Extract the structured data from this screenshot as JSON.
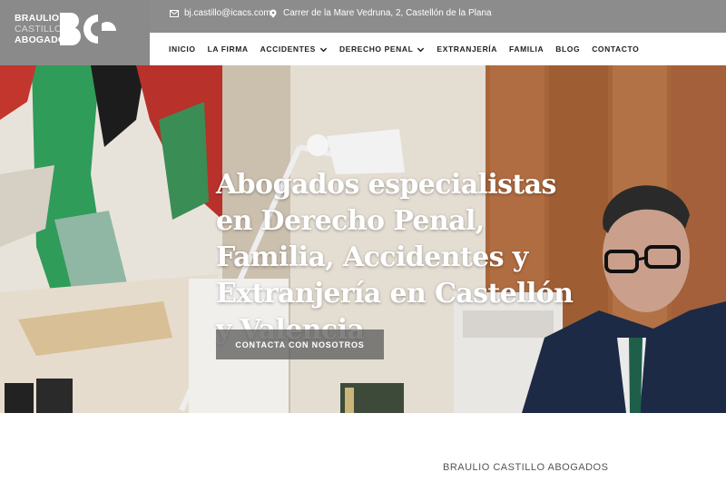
{
  "logo": {
    "line1": "BRAULIO",
    "line2": "CASTILLO",
    "line3": "ABOGADOS"
  },
  "topbar": {
    "email": "bj.castillo@icacs.com",
    "address": "Carrer de la Mare Vedruna, 2, Castellón de la Plana",
    "email_icon": "envelope-icon",
    "address_icon": "map-pin-icon"
  },
  "nav": {
    "items": [
      {
        "label": "INICIO",
        "dropdown": false
      },
      {
        "label": "LA FIRMA",
        "dropdown": false
      },
      {
        "label": "ACCIDENTES",
        "dropdown": true
      },
      {
        "label": "DERECHO PENAL",
        "dropdown": true
      },
      {
        "label": "EXTRANJERÍA",
        "dropdown": false
      },
      {
        "label": "FAMILIA",
        "dropdown": false
      },
      {
        "label": "BLOG",
        "dropdown": false
      },
      {
        "label": "CONTACTO",
        "dropdown": false
      }
    ]
  },
  "hero": {
    "title": "Abogados especialistas en Derecho Penal, Familia, Accidentes y Extranjería en Castellón y Valencia",
    "cta_label": "CONTACTA CON NOSOTROS"
  },
  "section": {
    "heading": "BRAULIO CASTILLO ABOGADOS"
  },
  "colors": {
    "logo_bg": "#8a8a8a",
    "topbar_bg": "#8c8c8c",
    "cta_bg": "#5a5a5a"
  }
}
